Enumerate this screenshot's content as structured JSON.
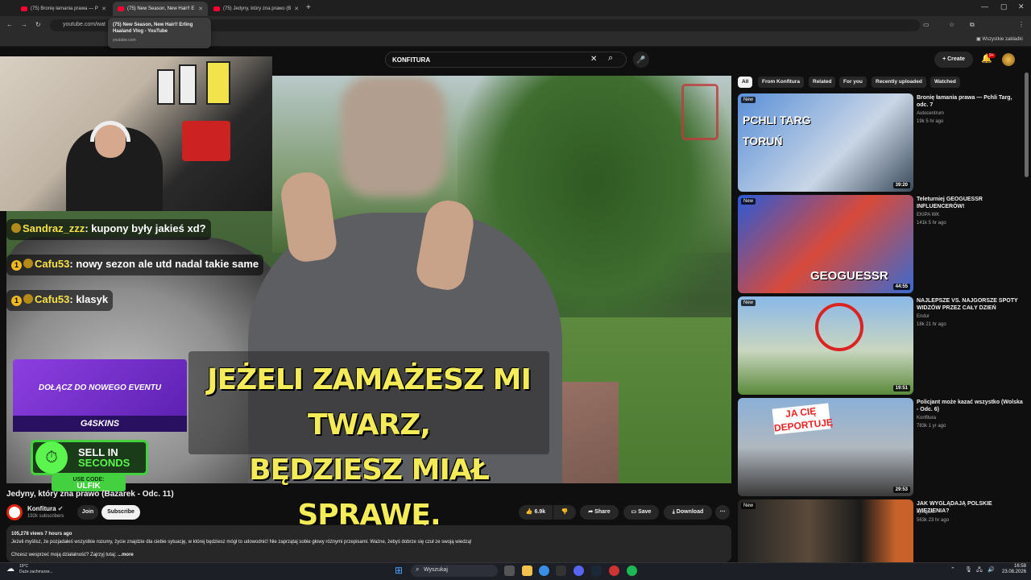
{
  "browser": {
    "tabs": [
      {
        "label": "(75) Bronię łamania prawa — P",
        "active": false
      },
      {
        "label": "(75) New Season, New Hair!! E",
        "active": true
      },
      {
        "label": "(75) Jedyny, który zna prawo (B",
        "active": false
      }
    ],
    "new_tab": "+",
    "url": "youtube.com/wat",
    "bookmarks_label": "Wszystkie zakładki",
    "tooltip": {
      "title": "(75) New Season, New Hair!! Erling Haaland Vlog - YouTube",
      "domain": "youtube.com"
    }
  },
  "youtube": {
    "search_value": "KONFITURA",
    "create_label": "Create",
    "notif_count": "9+",
    "video": {
      "title": "Jedyny, który zna prawo (Bazarek - Odc. 11)",
      "channel": "Konfitura",
      "subscribers": "192k subscribers",
      "join_label": "Join",
      "subscribe_label": "Subscribe",
      "likes": "6.9k",
      "share_label": "Share",
      "save_label": "Save",
      "download_label": "Download",
      "views_time": "105,278 views  7 hours ago",
      "description": "Jeżeli myślisz, że pozjadałeś wszystkie rozumy, życie znajdzie dla ciebie sytuację, w której będziesz mógł to udowodnić! Nie zaprzątaj sobie głowy różnymi przepisami. Ważne, żebyś dobrze się czuł ze swoją wiedzą!",
      "description2": "Chcesz wesprzeć moją działalność? Zajrzyj tutaj:",
      "more_label": "...more"
    },
    "overlay": {
      "chat": [
        {
          "user": "Sandraz_zzz",
          "msg": "kupony były jakieś xd?",
          "level": ""
        },
        {
          "user": "Cafu53",
          "msg": "nowy sezon ale utd nadal takie same",
          "level": "1"
        },
        {
          "user": "Cafu53",
          "msg": "klasyk",
          "level": "1"
        }
      ],
      "subtitle_line1": "JEŻELI ZAMAŻESZ MI TWARZ,",
      "subtitle_line2": "BĘDZIESZ MIAŁ SPRAWĘ.",
      "event_text": "DOŁĄCZ DO NOWEGO EVENTU",
      "event_brand": "G4SKINS",
      "sell_line1": "SELL IN",
      "sell_line2": "SECONDS",
      "code_label": "USE CODE:",
      "code_value": "ULFIK"
    },
    "chips": [
      "All",
      "From Konfitura",
      "Related",
      "For you",
      "Recently uploaded",
      "Watched"
    ],
    "recommendations": [
      {
        "title": "Bronię łamania prawa — Pchli Targ, odc. 7",
        "channel": "Autocentrum",
        "meta": "19k  5 hr ago",
        "duration": "39:20",
        "badge": "New",
        "thumb_text": "PCHLI TARG TORUŃ"
      },
      {
        "title": "Teleturniej GEOGUESSR INFLUENCERÓW!",
        "channel": "EKIPA WK",
        "meta": "141k  5 hr ago",
        "duration": "44:55",
        "badge": "New",
        "thumb_text": "GEOGUESSR"
      },
      {
        "title": "NAJLEPSZE VS. NAJGORSZE SPOTY WIDZÓW PRZEZ CAŁY DZIEŃ",
        "channel": "Endur",
        "meta": "18k  21 hr ago",
        "duration": "19:51",
        "badge": "New",
        "thumb_text": ""
      },
      {
        "title": "Policjant może kazać wszystko (Wolska - Odc. 6)",
        "channel": "Konfitura",
        "meta": "783k  1 yr ago",
        "duration": "29:53",
        "badge": "",
        "thumb_text": "JA CIĘ DEPORTUJĘ"
      },
      {
        "title": "JAK WYGLĄDAJĄ POLSKIE WIĘZIENIA?",
        "channel": "ojwojtek",
        "meta": "563k  23 hr ago",
        "duration": "",
        "badge": "New",
        "thumb_text": ""
      }
    ]
  },
  "taskbar": {
    "search_placeholder": "Wyszukaj",
    "weather_temp": "19°C",
    "weather_desc": "Duże zachmurze...",
    "time": "16:58",
    "date": "23.08.2026"
  },
  "colors": {
    "accent": "#ff0033",
    "subtitle": "#f3eb57",
    "sell_green": "#43d13f",
    "event_purple": "#8d3fe0"
  }
}
